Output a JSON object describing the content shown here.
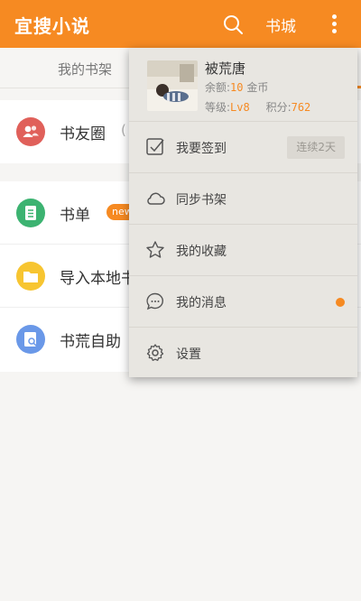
{
  "appbar": {
    "title": "宜搜小说",
    "city_label": "书城",
    "colors": {
      "accent": "#f68a22"
    }
  },
  "tabs": {
    "items": [
      {
        "label": "我的书架"
      }
    ]
  },
  "list": {
    "items": [
      {
        "label": "书友圈",
        "icon": "users-icon",
        "color": "#e0605a",
        "paren": "("
      },
      {
        "label": "书单",
        "icon": "list-icon",
        "color": "#3cb371",
        "badge": "new"
      },
      {
        "label": "导入本地书",
        "icon": "folder-icon",
        "color": "#f7c531"
      },
      {
        "label": "书荒自助",
        "icon": "book-search-icon",
        "color": "#6a98e8"
      }
    ]
  },
  "menu": {
    "profile": {
      "username": "被荒唐",
      "balance_label": "余额:",
      "balance_value": "10",
      "balance_unit": " 金币",
      "level_label": "等级:",
      "level_value": "Lv8",
      "points_label": "积分:",
      "points_value": "762"
    },
    "items": [
      {
        "label": "我要签到",
        "icon": "checkin-icon",
        "action": "连续2天"
      },
      {
        "label": "同步书架",
        "icon": "cloud-icon"
      },
      {
        "label": "我的收藏",
        "icon": "star-icon"
      },
      {
        "label": "我的消息",
        "icon": "message-icon",
        "has_dot": true
      },
      {
        "label": "设置",
        "icon": "gear-icon"
      }
    ]
  }
}
